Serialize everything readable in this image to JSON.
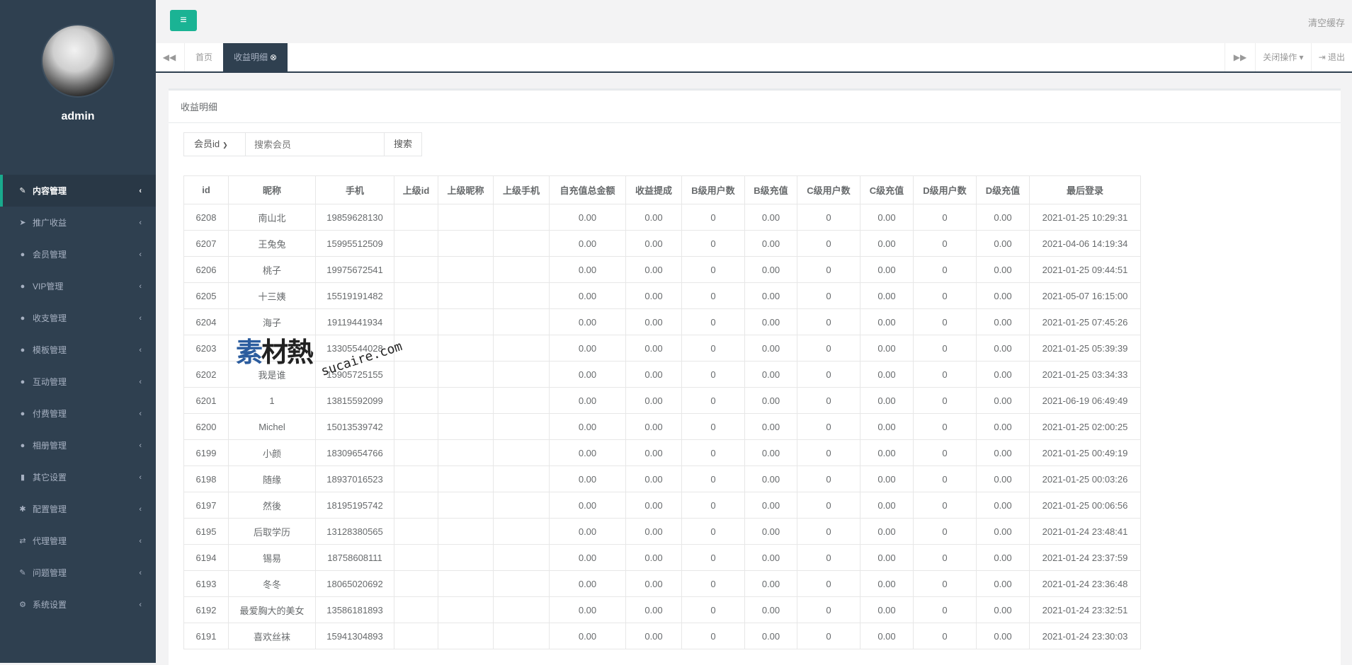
{
  "sidebar": {
    "username": "admin",
    "items": [
      {
        "label": "内容管理",
        "icon": "edit-icon",
        "glyph": "✎"
      },
      {
        "label": "推广收益",
        "icon": "paper-plane-icon",
        "glyph": "➤"
      },
      {
        "label": "会员管理",
        "icon": "user-icon",
        "glyph": "●"
      },
      {
        "label": "VIP管理",
        "icon": "user-icon",
        "glyph": "●"
      },
      {
        "label": "收支管理",
        "icon": "user-icon",
        "glyph": "●"
      },
      {
        "label": "模板管理",
        "icon": "user-icon",
        "glyph": "●"
      },
      {
        "label": "互动管理",
        "icon": "user-icon",
        "glyph": "●"
      },
      {
        "label": "付费管理",
        "icon": "user-icon",
        "glyph": "●"
      },
      {
        "label": "相册管理",
        "icon": "user-icon",
        "glyph": "●"
      },
      {
        "label": "其它设置",
        "icon": "book-icon",
        "glyph": "▮"
      },
      {
        "label": "配置管理",
        "icon": "asterisk-icon",
        "glyph": "✱"
      },
      {
        "label": "代理管理",
        "icon": "exchange-icon",
        "glyph": "⇄"
      },
      {
        "label": "问题管理",
        "icon": "edit-icon",
        "glyph": "✎"
      },
      {
        "label": "系统设置",
        "icon": "cogs-icon",
        "glyph": "⚙"
      }
    ]
  },
  "topbar": {
    "menu_icon": "≡",
    "clear_cache": "清空缓存"
  },
  "tabs": {
    "back_icon": "◀◀",
    "home": "首页",
    "active": "收益明细",
    "close_icon": "⊗",
    "forward_icon": "▶▶",
    "close_ops": "关闭操作",
    "logout": "退出"
  },
  "panel": {
    "title": "收益明细"
  },
  "search": {
    "select_value": "会员id",
    "placeholder": "搜索会员",
    "button": "搜索"
  },
  "table": {
    "columns": [
      "id",
      "昵称",
      "手机",
      "上级id",
      "上级昵称",
      "上级手机",
      "自充值总金额",
      "收益提成",
      "B级用户数",
      "B级充值",
      "C级用户数",
      "C级充值",
      "D级用户数",
      "D级充值",
      "最后登录"
    ],
    "rows": [
      [
        "6208",
        "南山北",
        "19859628130",
        "",
        "",
        "",
        "0.00",
        "0.00",
        "0",
        "0.00",
        "0",
        "0.00",
        "0",
        "0.00",
        "2021-01-25 10:29:31"
      ],
      [
        "6207",
        "王兔兔",
        "15995512509",
        "",
        "",
        "",
        "0.00",
        "0.00",
        "0",
        "0.00",
        "0",
        "0.00",
        "0",
        "0.00",
        "2021-04-06 14:19:34"
      ],
      [
        "6206",
        "桃子",
        "19975672541",
        "",
        "",
        "",
        "0.00",
        "0.00",
        "0",
        "0.00",
        "0",
        "0.00",
        "0",
        "0.00",
        "2021-01-25 09:44:51"
      ],
      [
        "6205",
        "十三姨",
        "15519191482",
        "",
        "",
        "",
        "0.00",
        "0.00",
        "0",
        "0.00",
        "0",
        "0.00",
        "0",
        "0.00",
        "2021-05-07 16:15:00"
      ],
      [
        "6204",
        "海子",
        "19119441934",
        "",
        "",
        "",
        "0.00",
        "0.00",
        "0",
        "0.00",
        "0",
        "0.00",
        "0",
        "0.00",
        "2021-01-25 07:45:26"
      ],
      [
        "6203",
        "",
        "13305544028",
        "",
        "",
        "",
        "0.00",
        "0.00",
        "0",
        "0.00",
        "0",
        "0.00",
        "0",
        "0.00",
        "2021-01-25 05:39:39"
      ],
      [
        "6202",
        "我是谁",
        "15905725155",
        "",
        "",
        "",
        "0.00",
        "0.00",
        "0",
        "0.00",
        "0",
        "0.00",
        "0",
        "0.00",
        "2021-01-25 03:34:33"
      ],
      [
        "6201",
        "1",
        "13815592099",
        "",
        "",
        "",
        "0.00",
        "0.00",
        "0",
        "0.00",
        "0",
        "0.00",
        "0",
        "0.00",
        "2021-06-19 06:49:49"
      ],
      [
        "6200",
        "Michel",
        "15013539742",
        "",
        "",
        "",
        "0.00",
        "0.00",
        "0",
        "0.00",
        "0",
        "0.00",
        "0",
        "0.00",
        "2021-01-25 02:00:25"
      ],
      [
        "6199",
        "小颜",
        "18309654766",
        "",
        "",
        "",
        "0.00",
        "0.00",
        "0",
        "0.00",
        "0",
        "0.00",
        "0",
        "0.00",
        "2021-01-25 00:49:19"
      ],
      [
        "6198",
        "随缘",
        "18937016523",
        "",
        "",
        "",
        "0.00",
        "0.00",
        "0",
        "0.00",
        "0",
        "0.00",
        "0",
        "0.00",
        "2021-01-25 00:03:26"
      ],
      [
        "6197",
        "然後",
        "18195195742",
        "",
        "",
        "",
        "0.00",
        "0.00",
        "0",
        "0.00",
        "0",
        "0.00",
        "0",
        "0.00",
        "2021-01-25 00:06:56"
      ],
      [
        "6195",
        "后取学历",
        "13128380565",
        "",
        "",
        "",
        "0.00",
        "0.00",
        "0",
        "0.00",
        "0",
        "0.00",
        "0",
        "0.00",
        "2021-01-24 23:48:41"
      ],
      [
        "6194",
        "锡易",
        "18758608111",
        "",
        "",
        "",
        "0.00",
        "0.00",
        "0",
        "0.00",
        "0",
        "0.00",
        "0",
        "0.00",
        "2021-01-24 23:37:59"
      ],
      [
        "6193",
        "冬冬",
        "18065020692",
        "",
        "",
        "",
        "0.00",
        "0.00",
        "0",
        "0.00",
        "0",
        "0.00",
        "0",
        "0.00",
        "2021-01-24 23:36:48"
      ],
      [
        "6192",
        "最爱胸大的美女",
        "13586181893",
        "",
        "",
        "",
        "0.00",
        "0.00",
        "0",
        "0.00",
        "0",
        "0.00",
        "0",
        "0.00",
        "2021-01-24 23:32:51"
      ],
      [
        "6191",
        "喜欢丝袜",
        "15941304893",
        "",
        "",
        "",
        "0.00",
        "0.00",
        "0",
        "0.00",
        "0",
        "0.00",
        "0",
        "0.00",
        "2021-01-24 23:30:03"
      ]
    ]
  },
  "watermark": {
    "logo_a": "素",
    "logo_b": "材熱",
    "site": "sucaire.com"
  }
}
